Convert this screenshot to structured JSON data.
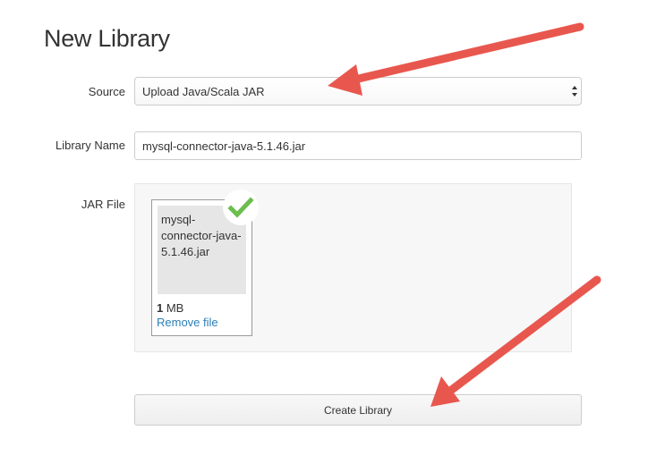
{
  "page": {
    "title": "New Library"
  },
  "form": {
    "source": {
      "label": "Source",
      "selected": "Upload Java/Scala JAR"
    },
    "library_name": {
      "label": "Library Name",
      "value": "mysql-connector-java-5.1.46.jar"
    },
    "jar_file": {
      "label": "JAR File",
      "file": {
        "name": "mysql-connector-java-5.1.46.jar",
        "size_number": "1",
        "size_unit": " MB",
        "remove_label": "Remove file",
        "status_icon": "checkmark-icon"
      }
    },
    "submit_label": "Create Library"
  },
  "colors": {
    "annotation_arrow": "#e8574e",
    "success_check": "#6bbd4e",
    "link": "#2a7fb8"
  }
}
